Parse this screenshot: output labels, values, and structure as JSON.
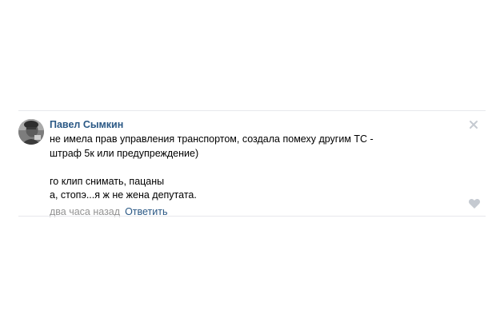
{
  "comment": {
    "author": "Павел Сымкин",
    "text_lines": [
      "не имела прав управления транспортом, создала помеху другим ТС -",
      "штраф 5к или предупреждение)",
      "",
      "го клип снимать, пацаны",
      "а, стопэ...я ж не жена депутата."
    ],
    "time": "два часа назад",
    "reply_label": "Ответить"
  },
  "icons": {
    "close": "close-icon",
    "like": "heart-icon",
    "avatar": "avatar-photo"
  },
  "colors": {
    "link": "#2a5885",
    "meta": "#939393",
    "divider": "#e7e8ec",
    "icon": "#c5cad1"
  }
}
